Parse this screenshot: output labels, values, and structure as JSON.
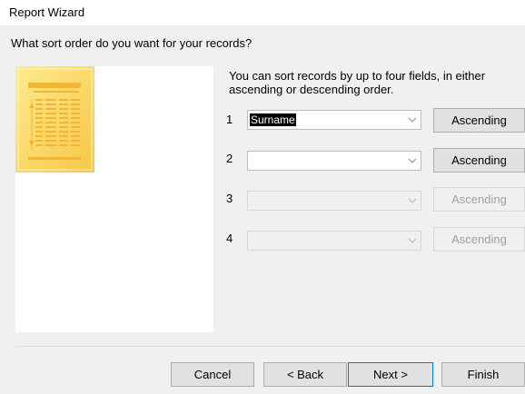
{
  "window": {
    "title": "Report Wizard"
  },
  "question": "What sort order do you want for your records?",
  "instructions": "You can sort records by up to four fields, in either ascending or descending order.",
  "sort_rows": [
    {
      "number": "1",
      "field": "Surname",
      "order": "Ascending",
      "enabled": true
    },
    {
      "number": "2",
      "field": "",
      "order": "Ascending",
      "enabled": true
    },
    {
      "number": "3",
      "field": "",
      "order": "Ascending",
      "enabled": false
    },
    {
      "number": "4",
      "field": "",
      "order": "Ascending",
      "enabled": false
    }
  ],
  "buttons": {
    "cancel": "Cancel",
    "back": "< Back",
    "next": "Next >",
    "finish": "Finish"
  },
  "colors": {
    "accent": "#0078d7",
    "graphic_light": "#ffe88a",
    "graphic_dark": "#f5c242"
  },
  "icons": {
    "report_graphic": "report-preview-icon",
    "dropdown": "chevron-down-icon"
  }
}
